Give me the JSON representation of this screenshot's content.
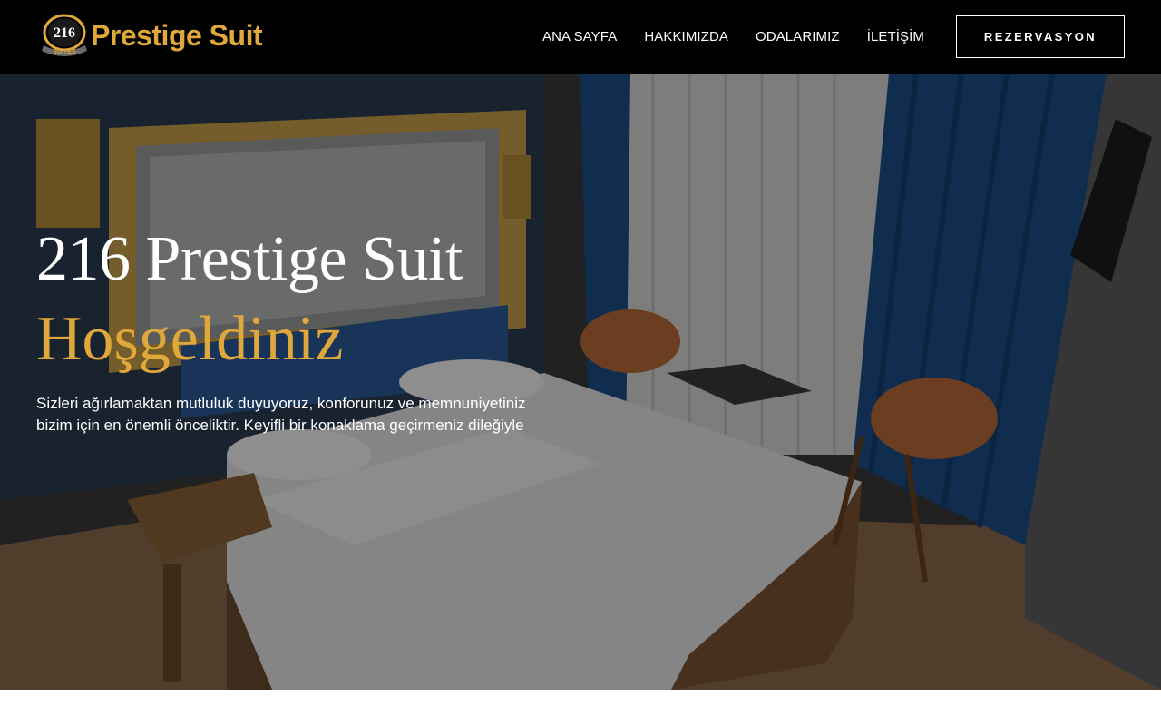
{
  "header": {
    "logo": {
      "badge_number": "216",
      "badge_word": "SUITES",
      "name": "Prestige Suit"
    },
    "nav": [
      {
        "label": "ANA SAYFA"
      },
      {
        "label": "HAKKIMIZDA"
      },
      {
        "label": "ODALARIMIZ"
      },
      {
        "label": "İLETİŞİM"
      }
    ],
    "reserve_label": "REZERVASYON"
  },
  "hero": {
    "title": "216 Prestige Suit",
    "subtitle": "Hoşgeldiniz",
    "text": "Sizleri ağırlamaktan mutluluk duyuyoruz, konforunuz ve memnuniyetiniz bizim için en önemli önceliktir. Keyifli bir konaklama geçirmeniz dileğiyle"
  },
  "colors": {
    "header_bg": "#000000",
    "accent_gold": "#e0a83a",
    "text": "#ffffff",
    "curtain_blue": "#1c4f88"
  }
}
